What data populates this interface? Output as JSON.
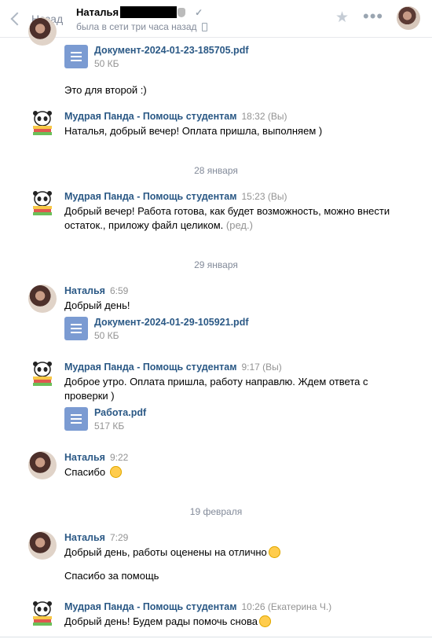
{
  "header": {
    "back_label": "Назад",
    "peer_name": "Наталья",
    "peer_status": "была в сети три часа назад"
  },
  "messages": {
    "m0": {
      "doc_name": "Документ-2024-01-23-185705.pdf",
      "doc_size": "50 КБ",
      "text2": "Это для второй :)"
    },
    "m1": {
      "author": "Мудрая Панда - Помощь студентам",
      "time": "18:32 (Вы)",
      "text": "Наталья, добрый вечер! Оплата пришла, выполняем )"
    },
    "d1": "28 января",
    "m2": {
      "author": "Мудрая Панда - Помощь студентам",
      "time": "15:23 (Вы)",
      "text": "Добрый вечер! Работа готова, как будет возможность, можно внести остаток., приложу файл целиком.",
      "edited": "(ред.)"
    },
    "d2": "29 января",
    "m3": {
      "author": "Наталья",
      "time": "6:59",
      "text": "Добрый день!",
      "doc_name": "Документ-2024-01-29-105921.pdf",
      "doc_size": "50 КБ"
    },
    "m4": {
      "author": "Мудрая Панда - Помощь студентам",
      "time": "9:17 (Вы)",
      "text": "Доброе утро. Оплата пришла, работу направлю. Ждем ответа с проверки )",
      "doc_name": "Работа.pdf",
      "doc_size": "517 КБ"
    },
    "m5": {
      "author": "Наталья",
      "time": "9:22",
      "text": "Спасибо"
    },
    "d3": "19 февраля",
    "m6": {
      "author": "Наталья",
      "time": "7:29",
      "text": "Добрый день, работы оценены на отлично",
      "text2": "Спасибо за помощь"
    },
    "m7": {
      "author": "Мудрая Панда - Помощь студентам",
      "time": "10:26 (Екатерина Ч.)",
      "text": "Добрый день! Будем рады помочь снова"
    }
  },
  "icons": {
    "back": "chevron-left-icon",
    "favorite": "star-icon",
    "more": "more-dots-icon",
    "document": "document-icon"
  },
  "colors": {
    "link": "#2a5885",
    "muted": "#939393",
    "doc_icon": "#7b9bd2"
  }
}
